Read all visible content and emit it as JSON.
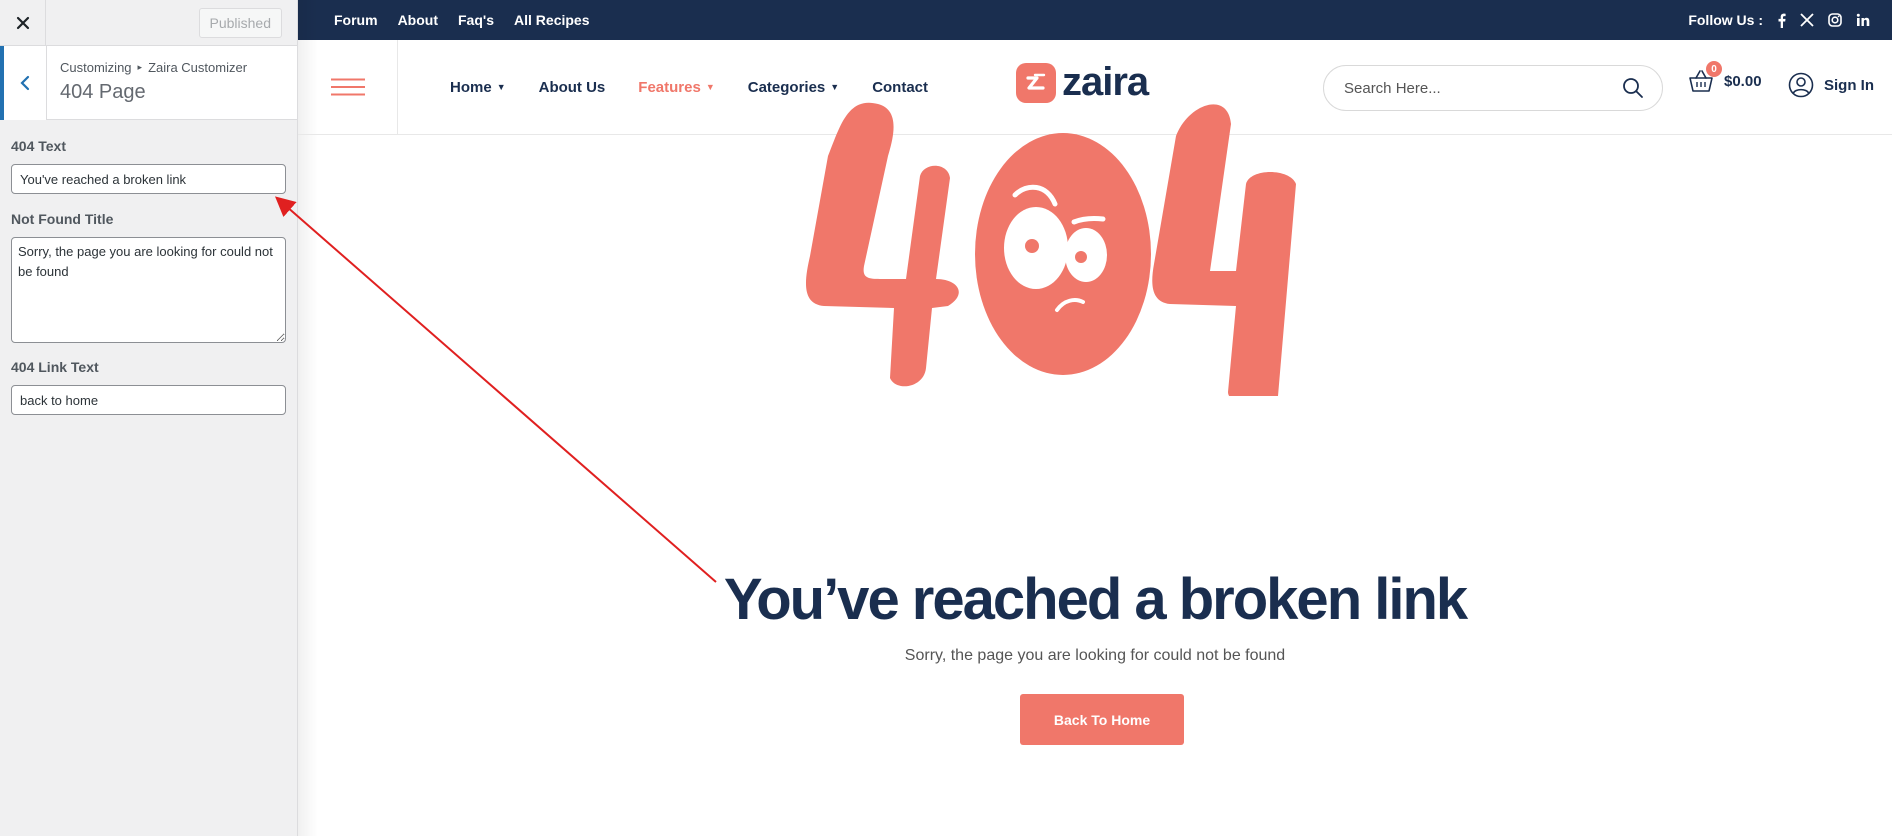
{
  "customizer": {
    "published_label": "Published",
    "breadcrumb": [
      "Customizing",
      "Zaira Customizer"
    ],
    "section_title": "404 Page",
    "controls": {
      "text_label": "404 Text",
      "text_value": "You've reached a broken link",
      "title_label": "Not Found Title",
      "title_value": "Sorry, the page you are looking for could not be found",
      "link_label": "404 Link Text",
      "link_value": "back to home"
    }
  },
  "site": {
    "topbar": {
      "links": [
        "Forum",
        "About",
        "Faq's",
        "All Recipes"
      ],
      "follow_label": "Follow Us :",
      "social": [
        "facebook-icon",
        "x-icon",
        "instagram-icon",
        "linkedin-icon"
      ]
    },
    "nav": {
      "items": [
        {
          "label": "Home",
          "dropdown": true
        },
        {
          "label": "About Us",
          "dropdown": false
        },
        {
          "label": "Features",
          "dropdown": true
        },
        {
          "label": "Categories",
          "dropdown": true
        },
        {
          "label": "Contact",
          "dropdown": false
        }
      ],
      "logo_text": "zaira",
      "search_placeholder": "Search Here...",
      "cart_count": "0",
      "cart_amount": "$0.00",
      "signin_label": "Sign In"
    },
    "error_page": {
      "code": "404",
      "headline": "You’ve reached a broken link",
      "subtitle": "Sorry, the page you are looking for could not be found",
      "button_label": "Back To Home"
    }
  },
  "colors": {
    "accent": "#f0776a",
    "navy": "#1a2e4f",
    "wp_blue": "#2271b1",
    "annotation_arrow": "#e02020"
  }
}
